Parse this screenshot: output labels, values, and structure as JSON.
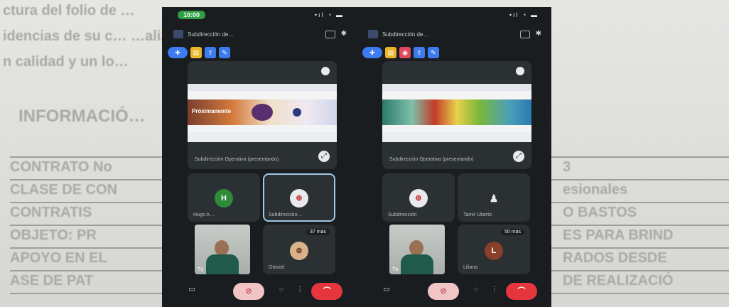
{
  "document": {
    "lines": [
      "ctura del folio de …",
      "idencias de su c…   …alizados sean he…",
      "n calidad y un lo…"
    ],
    "heading": "INFORMACIÓ…",
    "rows": [
      {
        "left": "CONTRATO No",
        "right": "3"
      },
      {
        "left": "CLASE DE CON",
        "right": "esionales"
      },
      {
        "left": "CONTRATIS",
        "right": "O BASTOS"
      },
      {
        "left": "OBJETO: PR",
        "right": "ES PARA BRIND"
      },
      {
        "left": "APOYO EN EL",
        "right": "RADOS DESDE"
      },
      {
        "left": "ASE DE PAT",
        "right": "DE REALIZACIÓ"
      }
    ]
  },
  "phones": [
    {
      "status_time": "10:00",
      "status_icons": "•ıl ◔ ▬",
      "room_title": "Subdirección de…",
      "bt_icon": "✱",
      "share_caption": "Subdirección Operativa (presentando)",
      "share_banner_text": "Próximamente",
      "participants": [
        {
          "initial": "H",
          "name": "Hugo A…",
          "color": "#2e8b3c"
        },
        {
          "initial": "⊕",
          "name": "Subdirección…",
          "color": "#e8eaed"
        }
      ],
      "third_tile": {
        "initial": "⊗",
        "name": "Otoniel",
        "badge": "37 más"
      },
      "self_label": "Tú"
    },
    {
      "status_time": "",
      "status_icons": "•ıl ◔ ▬",
      "room_title": "Subdirección de…",
      "bt_icon": "✱",
      "share_caption": "Subdirección Operativa (presentando)",
      "share_banner_text": "",
      "participants": [
        {
          "initial": "⊕",
          "name": "Subdirección",
          "color": "#e8eaed"
        },
        {
          "initial": "♟",
          "name": "Tamir Uberto",
          "color": "#e8eaed"
        }
      ],
      "third_tile": {
        "initial": "L",
        "name": "Liliana",
        "badge": "50 más"
      },
      "self_label": "Tú"
    }
  ],
  "colors": {
    "accent_blue": "#3d7bf0",
    "hangup_red": "#e5363e",
    "mic_pink": "#f1c4c6",
    "status_green": "#2ea043"
  }
}
